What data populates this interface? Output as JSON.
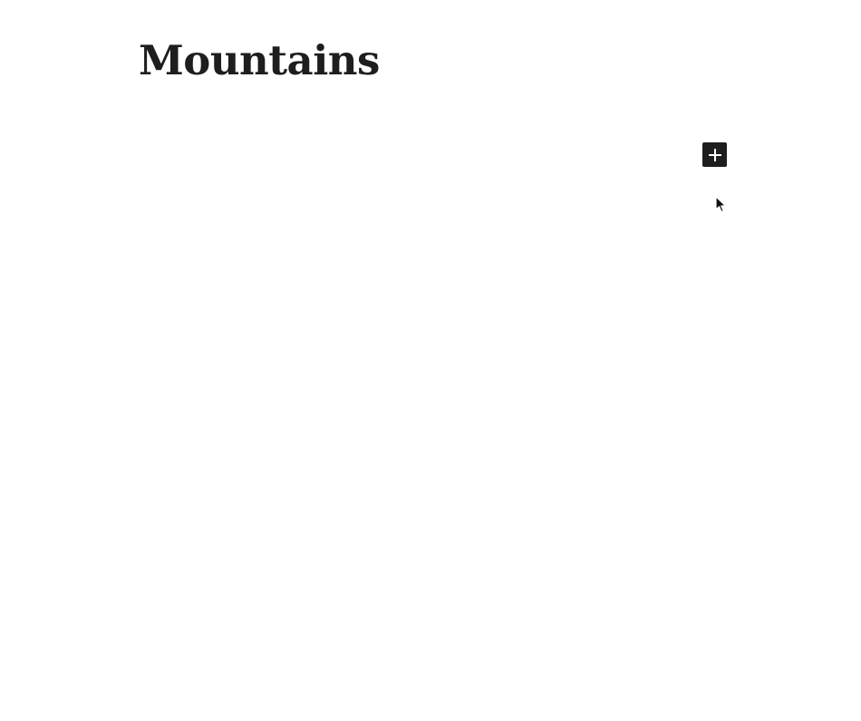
{
  "post": {
    "title": "Mountains"
  },
  "inserter": {
    "icon": "plus-icon",
    "accent_color": "#1e1e1e"
  },
  "cursor": {
    "icon": "mouse-pointer-icon"
  }
}
